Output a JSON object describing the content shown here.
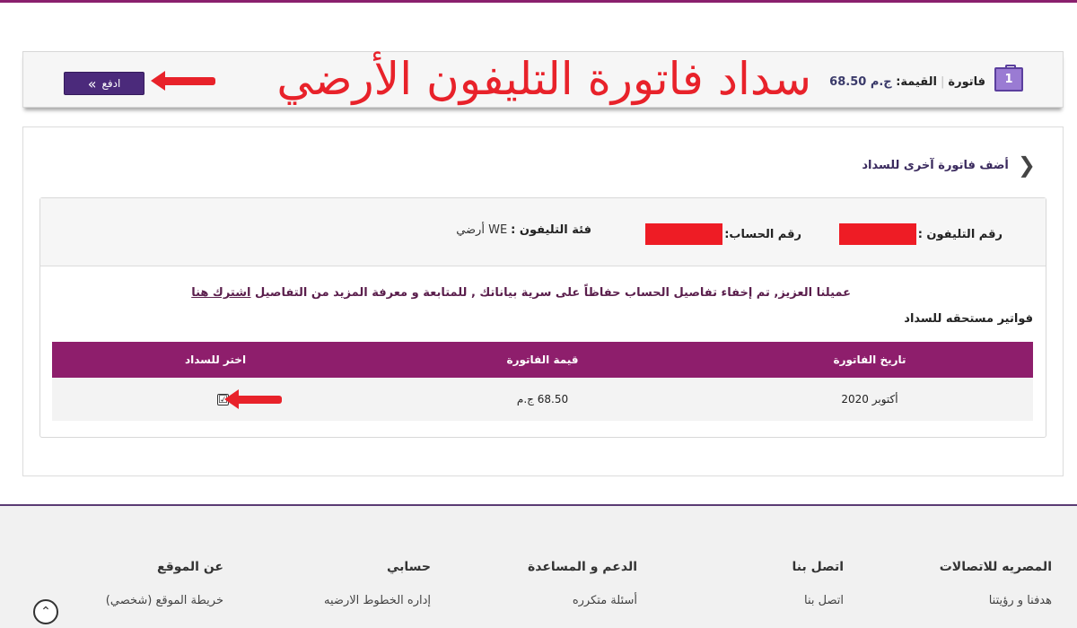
{
  "summary": {
    "badge_count": "1",
    "bill_label": "فاتورة",
    "value_label": "القيمة:",
    "value_amount": "ج.م 68.50",
    "overlay_title": "سداد فاتورة التليفون الأرضي",
    "pay_button_label": "ادفع",
    "pay_button_icon": "»"
  },
  "main": {
    "add_bill_label": "أضف فاتورة آخرى للسداد",
    "add_bill_icon": "❮",
    "account_info": {
      "phone_label": "رقم التليفون :",
      "account_label": "رقم الحساب:",
      "category_label": "فئة التليفون :",
      "category_value": "WE أرضي"
    },
    "notice_text": "عميلنا العزيز, تم إخفاء تفاصيل الحساب حفاظاً على سرية بياناتك , للمتابعة و معرفة المزيد من التفاصيل ",
    "notice_link": "اشترك هنا",
    "due_title": "فواتير مستحقه للسداد",
    "table": {
      "headers": [
        "تاريخ الفاتورة",
        "قيمة الفاتورة",
        "اختر للسداد"
      ],
      "rows": [
        {
          "date": "أكتوبر 2020",
          "amount": "68.50 ج.م",
          "selected": "☑"
        }
      ]
    }
  },
  "footer": {
    "columns": [
      {
        "heading": "المصريه للاتصالات",
        "link": "هدفنا و رؤيتنا"
      },
      {
        "heading": "اتصل بنا",
        "link": "اتصل بنا"
      },
      {
        "heading": "الدعم و المساعدة",
        "link": "أسئلة متكرره"
      },
      {
        "heading": "حسابي",
        "link": "إداره الخطوط الارضيه"
      },
      {
        "heading": "عن الموقع",
        "link": "خريطة الموقع (شخصي)"
      }
    ],
    "scroll_top_icon": "⌃"
  },
  "colors": {
    "brand_purple": "#8e1e6c",
    "button_purple": "#4b2a7b",
    "annotation_red": "#e8222a"
  }
}
